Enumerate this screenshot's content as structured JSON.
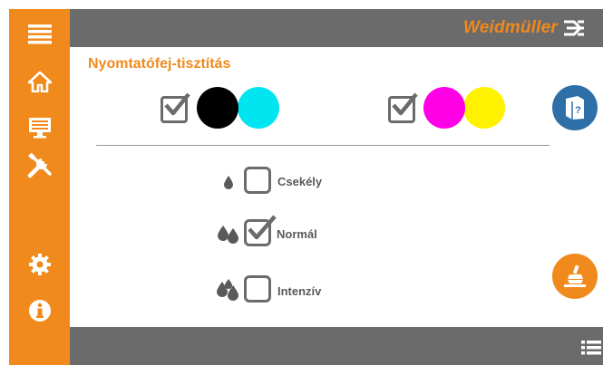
{
  "brand": {
    "name": "Weidmüller"
  },
  "page": {
    "title": "Nyomtatófej-tisztítás"
  },
  "sidebar": {
    "items": [
      {
        "icon": "menu-icon"
      },
      {
        "icon": "home-icon"
      },
      {
        "icon": "monitor-icon"
      },
      {
        "icon": "tools-icon"
      },
      {
        "icon": "gear-icon"
      },
      {
        "icon": "info-icon"
      }
    ]
  },
  "ink_groups": [
    {
      "checked": true,
      "colors": [
        "#000000",
        "#00e5f0"
      ]
    },
    {
      "checked": true,
      "colors": [
        "#ff00e6",
        "#fff200"
      ]
    }
  ],
  "cleaning_options": [
    {
      "label": "Csekély",
      "checked": false,
      "drops": 1
    },
    {
      "label": "Normál",
      "checked": true,
      "drops": 2
    },
    {
      "label": "Intenzív",
      "checked": false,
      "drops": 3
    }
  ],
  "colors": {
    "accent": "#f08a1c",
    "bar": "#6b6b6b",
    "help": "#2f6fa8"
  }
}
